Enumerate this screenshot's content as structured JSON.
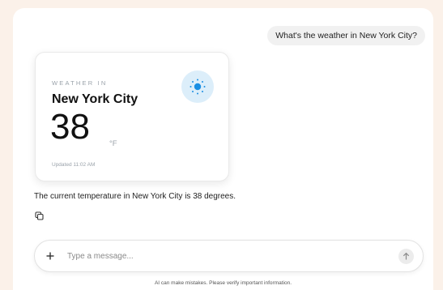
{
  "conversation": {
    "user_message": "What's the weather in New York City?",
    "assistant_reply": "The current temperature in New York City is 38 degrees."
  },
  "weather_card": {
    "kicker": "WEATHER IN",
    "city": "New York City",
    "temperature": "38",
    "unit": "°F",
    "updated": "Updated 11:02 AM",
    "icon": "sun-icon",
    "icon_color": "#1a8fe3",
    "icon_bg_color": "#dceefa"
  },
  "actions": {
    "copy_icon": "copy-icon"
  },
  "composer": {
    "placeholder": "Type a message...",
    "attach_icon": "plus-icon",
    "send_icon": "arrow-up-icon"
  },
  "footer": {
    "disclaimer": "AI can make mistakes. Please verify important information."
  }
}
